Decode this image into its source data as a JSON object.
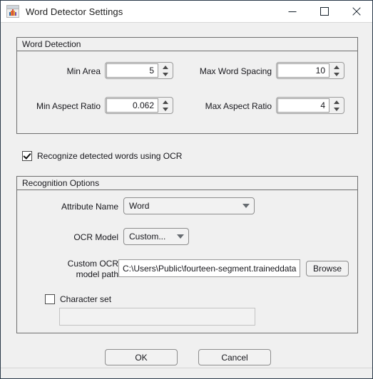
{
  "window": {
    "title": "Word Detector Settings",
    "icon": "matlab-icon",
    "controls": {
      "minimize": "minimize-icon",
      "maximize": "maximize-icon",
      "close": "close-icon"
    }
  },
  "word_detection": {
    "group_title": "Word Detection",
    "fields": [
      {
        "label": "Min Area",
        "value": "5"
      },
      {
        "label": "Max Word Spacing",
        "value": "10"
      },
      {
        "label": "Min Aspect Ratio",
        "value": "0.062"
      },
      {
        "label": "Max Aspect Ratio",
        "value": "4"
      }
    ]
  },
  "ocr_checkbox": {
    "label": "Recognize detected words using OCR",
    "checked": true
  },
  "recognition_options": {
    "group_title": "Recognition Options",
    "attribute_name": {
      "label": "Attribute Name",
      "value": "Word"
    },
    "ocr_model": {
      "label": "OCR Model",
      "value": "Custom..."
    },
    "custom_model_path": {
      "label_line1": "Custom OCR",
      "label_line2": "model path",
      "value": "C:\\Users\\Public\\fourteen-segment.traineddata",
      "browse_label": "Browse"
    },
    "character_set": {
      "label": "Character set",
      "checked": false,
      "value": "",
      "placeholder": ""
    }
  },
  "actions": {
    "ok_label": "OK",
    "cancel_label": "Cancel"
  },
  "colors": {
    "window_bg": "#f0f0f0",
    "titlebar_bg": "#ffffff",
    "border": "#6e6e6e",
    "text": "#17171c"
  }
}
